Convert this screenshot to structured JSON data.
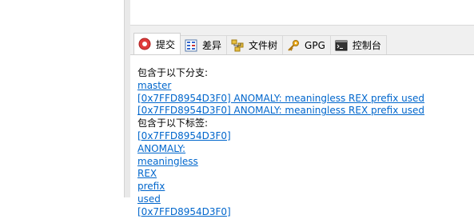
{
  "tabs": [
    {
      "label": "提交",
      "icon": "commit-icon",
      "active": true
    },
    {
      "label": "差异",
      "icon": "diff-icon",
      "active": false
    },
    {
      "label": "文件树",
      "icon": "file-tree-icon",
      "active": false
    },
    {
      "label": "GPG",
      "icon": "key-icon",
      "active": false
    },
    {
      "label": "控制台",
      "icon": "console-icon",
      "active": false
    }
  ],
  "details": {
    "branches_heading": "包含于以下分支:",
    "branches": [
      "master",
      "[0x7FFD8954D3F0] ANOMALY: meaningless REX prefix used",
      "[0x7FFD8954D3F0] ANOMALY: meaningless REX prefix used"
    ],
    "tags_heading": "包含于以下标签:",
    "tags": [
      "[0x7FFD8954D3F0]",
      "ANOMALY:",
      "meaningless",
      "REX",
      "prefix",
      "used",
      "[0x7FFD8954D3F0]"
    ]
  },
  "colors": {
    "link": "#0066cc",
    "tab_strip": "#f0f0f0",
    "commit_icon": "#e03a3a"
  }
}
